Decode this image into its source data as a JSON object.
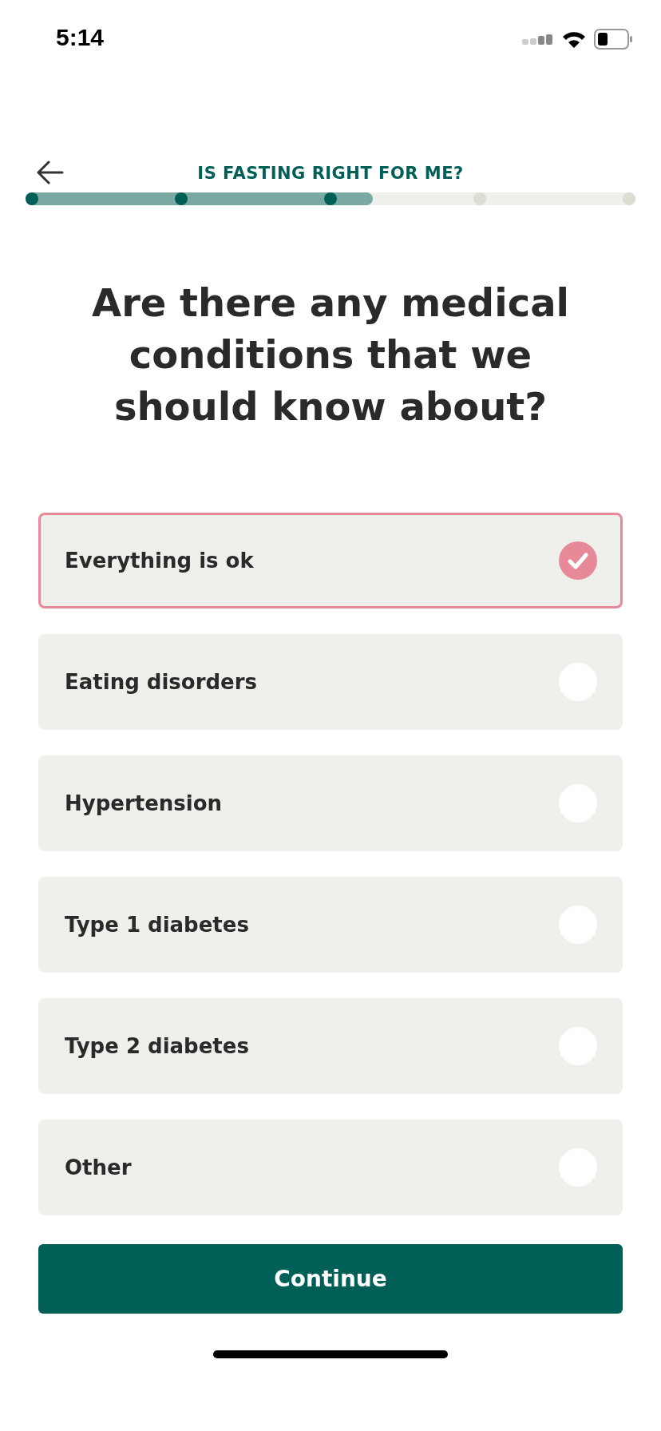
{
  "status_bar": {
    "time": "5:14"
  },
  "header": {
    "title": "IS FASTING RIGHT FOR ME?"
  },
  "progress": {
    "level": 0.57,
    "steps": [
      {
        "done": true
      },
      {
        "done": true
      },
      {
        "done": true
      },
      {
        "done": false
      },
      {
        "done": false
      }
    ]
  },
  "question": "Are there any medical conditions that we should know about?",
  "options": [
    {
      "label": "Everything is ok",
      "selected": true
    },
    {
      "label": "Eating disorders",
      "selected": false
    },
    {
      "label": "Hypertension",
      "selected": false
    },
    {
      "label": "Type 1 diabetes",
      "selected": false
    },
    {
      "label": "Type 2 diabetes",
      "selected": false
    },
    {
      "label": "Other",
      "selected": false
    }
  ],
  "continue_button": "Continue"
}
